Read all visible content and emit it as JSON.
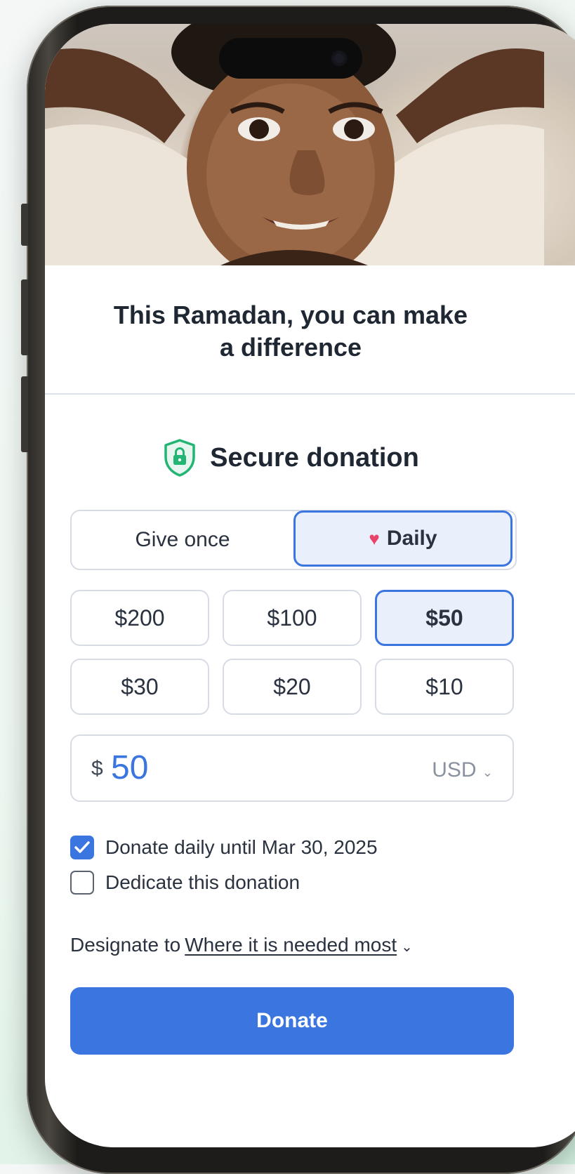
{
  "hero": {
    "alt": "Smiling child"
  },
  "headline": {
    "line1": "This Ramadan, you can make",
    "line2": "a difference"
  },
  "secure": {
    "label": "Secure donation",
    "icon": "shield-lock-icon",
    "color": "#22b573"
  },
  "frequency": {
    "once_label": "Give once",
    "daily_label": "Daily",
    "selected": "Daily"
  },
  "amounts": [
    "$200",
    "$100",
    "$50",
    "$30",
    "$20",
    "$10"
  ],
  "selected_amount": "$50",
  "custom": {
    "currency_symbol": "$",
    "value": "50",
    "currency": "USD"
  },
  "options": {
    "daily_until": {
      "label": "Donate daily until Mar 30, 2025",
      "checked": true
    },
    "dedicate": {
      "label": "Dedicate this donation",
      "checked": false
    }
  },
  "designate": {
    "prefix": "Designate to",
    "value": "Where it is needed most"
  },
  "donate_button": {
    "label": "Donate"
  },
  "colors": {
    "accent": "#3a75e0",
    "selected_bg": "#e9effb",
    "heart": "#e8446b",
    "text": "#1f2733"
  }
}
